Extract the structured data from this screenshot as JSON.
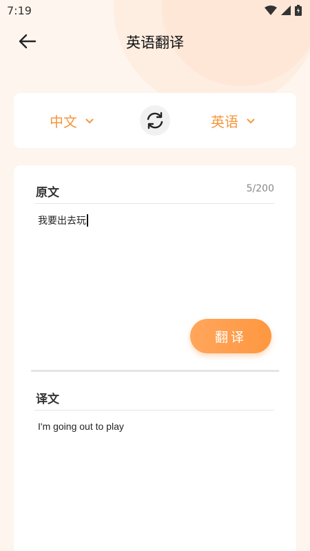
{
  "status": {
    "time": "7:19"
  },
  "header": {
    "title": "英语翻译"
  },
  "languages": {
    "source": "中文",
    "target": "英语"
  },
  "source": {
    "label": "原文",
    "count": "5/200",
    "text": "我要出去玩"
  },
  "translate_button": "翻译",
  "target": {
    "label": "译文",
    "text": "I'm going out to play"
  },
  "colors": {
    "accent": "#f5963b",
    "button": "#ff9e4f",
    "background": "#fdf5ee"
  },
  "icons": [
    "back-arrow-icon",
    "chevron-down-icon",
    "swap-icon",
    "wifi-icon",
    "signal-icon",
    "battery-icon"
  ]
}
